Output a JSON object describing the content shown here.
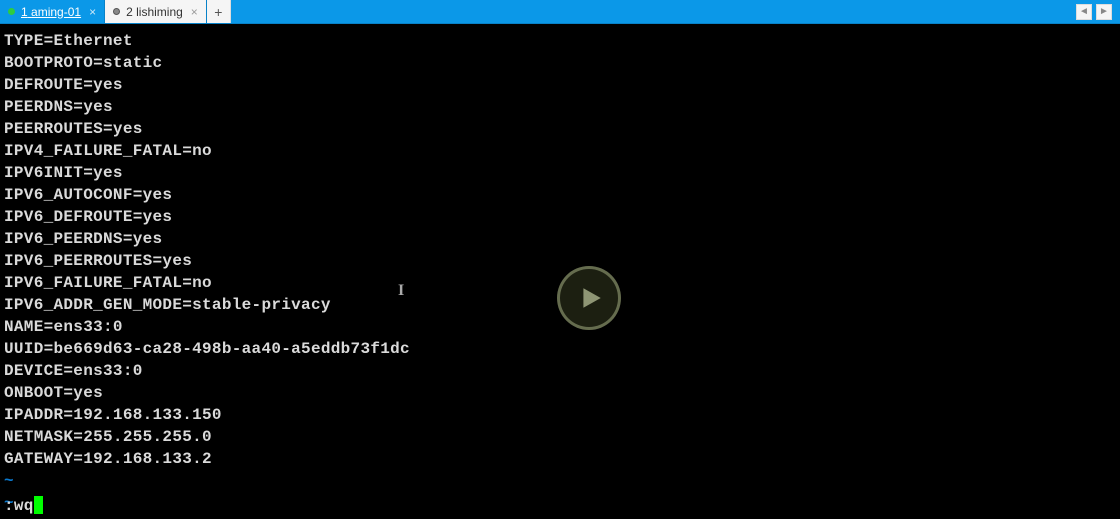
{
  "tabs": [
    {
      "index": "1",
      "label": "aming-01",
      "status": "connected"
    },
    {
      "index": "2",
      "label": "lishiming",
      "status": "modified"
    }
  ],
  "newTab": "+",
  "navRight": {
    "prev": "◄",
    "next": "►"
  },
  "terminal_lines": [
    "TYPE=Ethernet",
    "BOOTPROTO=static",
    "DEFROUTE=yes",
    "PEERDNS=yes",
    "PEERROUTES=yes",
    "IPV4_FAILURE_FATAL=no",
    "IPV6INIT=yes",
    "IPV6_AUTOCONF=yes",
    "IPV6_DEFROUTE=yes",
    "IPV6_PEERDNS=yes",
    "IPV6_PEERROUTES=yes",
    "IPV6_FAILURE_FATAL=no",
    "IPV6_ADDR_GEN_MODE=stable-privacy",
    "NAME=ens33:0",
    "UUID=be669d63-ca28-498b-aa40-a5eddb73f1dc",
    "DEVICE=ens33:0",
    "ONBOOT=yes",
    "IPADDR=192.168.133.150",
    "NETMASK=255.255.255.0",
    "GATEWAY=192.168.133.2"
  ],
  "tilde_lines": [
    "~",
    "~"
  ],
  "command": ":wq"
}
